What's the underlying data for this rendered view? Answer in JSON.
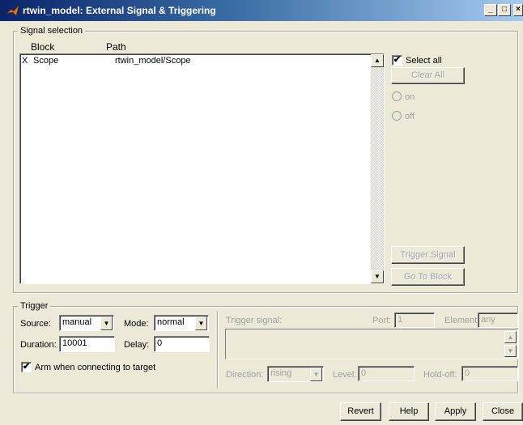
{
  "window": {
    "title": "rtwin_model: External Signal & Triggering",
    "minimize_label": "_",
    "maximize_label": "□",
    "close_label": "×"
  },
  "signal_selection": {
    "legend": "Signal selection",
    "columns": {
      "block": "Block",
      "path": "Path"
    },
    "rows": [
      {
        "marker": "X",
        "block": "Scope",
        "path": "rtwin_model/Scope"
      }
    ],
    "select_all_label": "Select all",
    "select_all_checked": true,
    "clear_all_label": "Clear All",
    "on_label": "on",
    "off_label": "off",
    "trigger_signal_label": "Trigger Signal",
    "go_to_block_label": "Go To Block"
  },
  "trigger": {
    "legend": "Trigger",
    "source_label": "Source:",
    "source_value": "manual",
    "mode_label": "Mode:",
    "mode_value": "normal",
    "duration_label": "Duration:",
    "duration_value": "10001",
    "delay_label": "Delay:",
    "delay_value": "0",
    "arm_label": "Arm when connecting to target",
    "arm_checked": true,
    "trigger_signal_label": "Trigger signal:",
    "port_label": "Port:",
    "port_value": "1",
    "element_label": "Element:",
    "element_value": "any",
    "direction_label": "Direction:",
    "direction_value": "rising",
    "level_label": "Level:",
    "level_value": "0",
    "holdoff_label": "Hold-off:",
    "holdoff_value": "0"
  },
  "footer": {
    "revert_label": "Revert",
    "help_label": "Help",
    "apply_label": "Apply",
    "close_label": "Close"
  },
  "glyphs": {
    "check": "✔",
    "arrow_up": "▲",
    "arrow_down": "▼"
  }
}
